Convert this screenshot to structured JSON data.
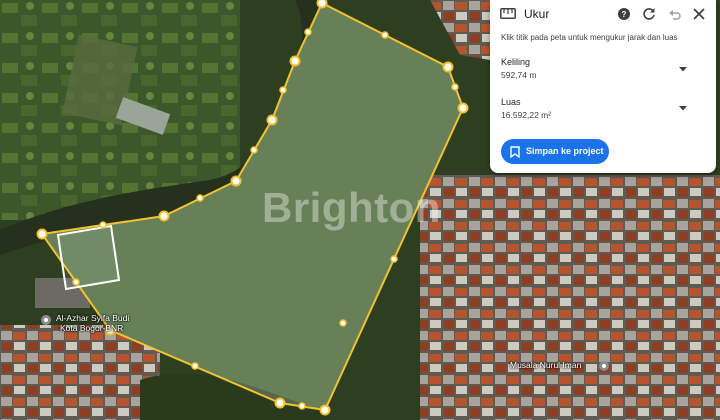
{
  "measure_panel": {
    "title": "Ukur",
    "instruction": "Klik titik pada peta untuk mengukur jarak dan luas",
    "perimeter_label": "Keliling",
    "perimeter_value": "592,74 m",
    "area_label": "Luas",
    "area_value": "16.592,22 m²",
    "save_label": "Simpan ke project",
    "icons": [
      "ruler-icon",
      "help-icon",
      "refresh-icon",
      "undo-icon",
      "close-icon",
      "chevron-down-icon",
      "bookmark-icon"
    ],
    "accent_color": "#1a73e8"
  },
  "map": {
    "watermark": "Brighton",
    "places": [
      {
        "name": "Al-Azhar Syifa Budi",
        "subtitle": "Kota Bogor-BNR"
      },
      {
        "name": "Musala Nurul Iman"
      }
    ],
    "polygon_stroke_color": "#f2c230",
    "polygon_fill_color": "rgba(255,255,255,0.22)",
    "square_outline_color": "#ffffff"
  }
}
